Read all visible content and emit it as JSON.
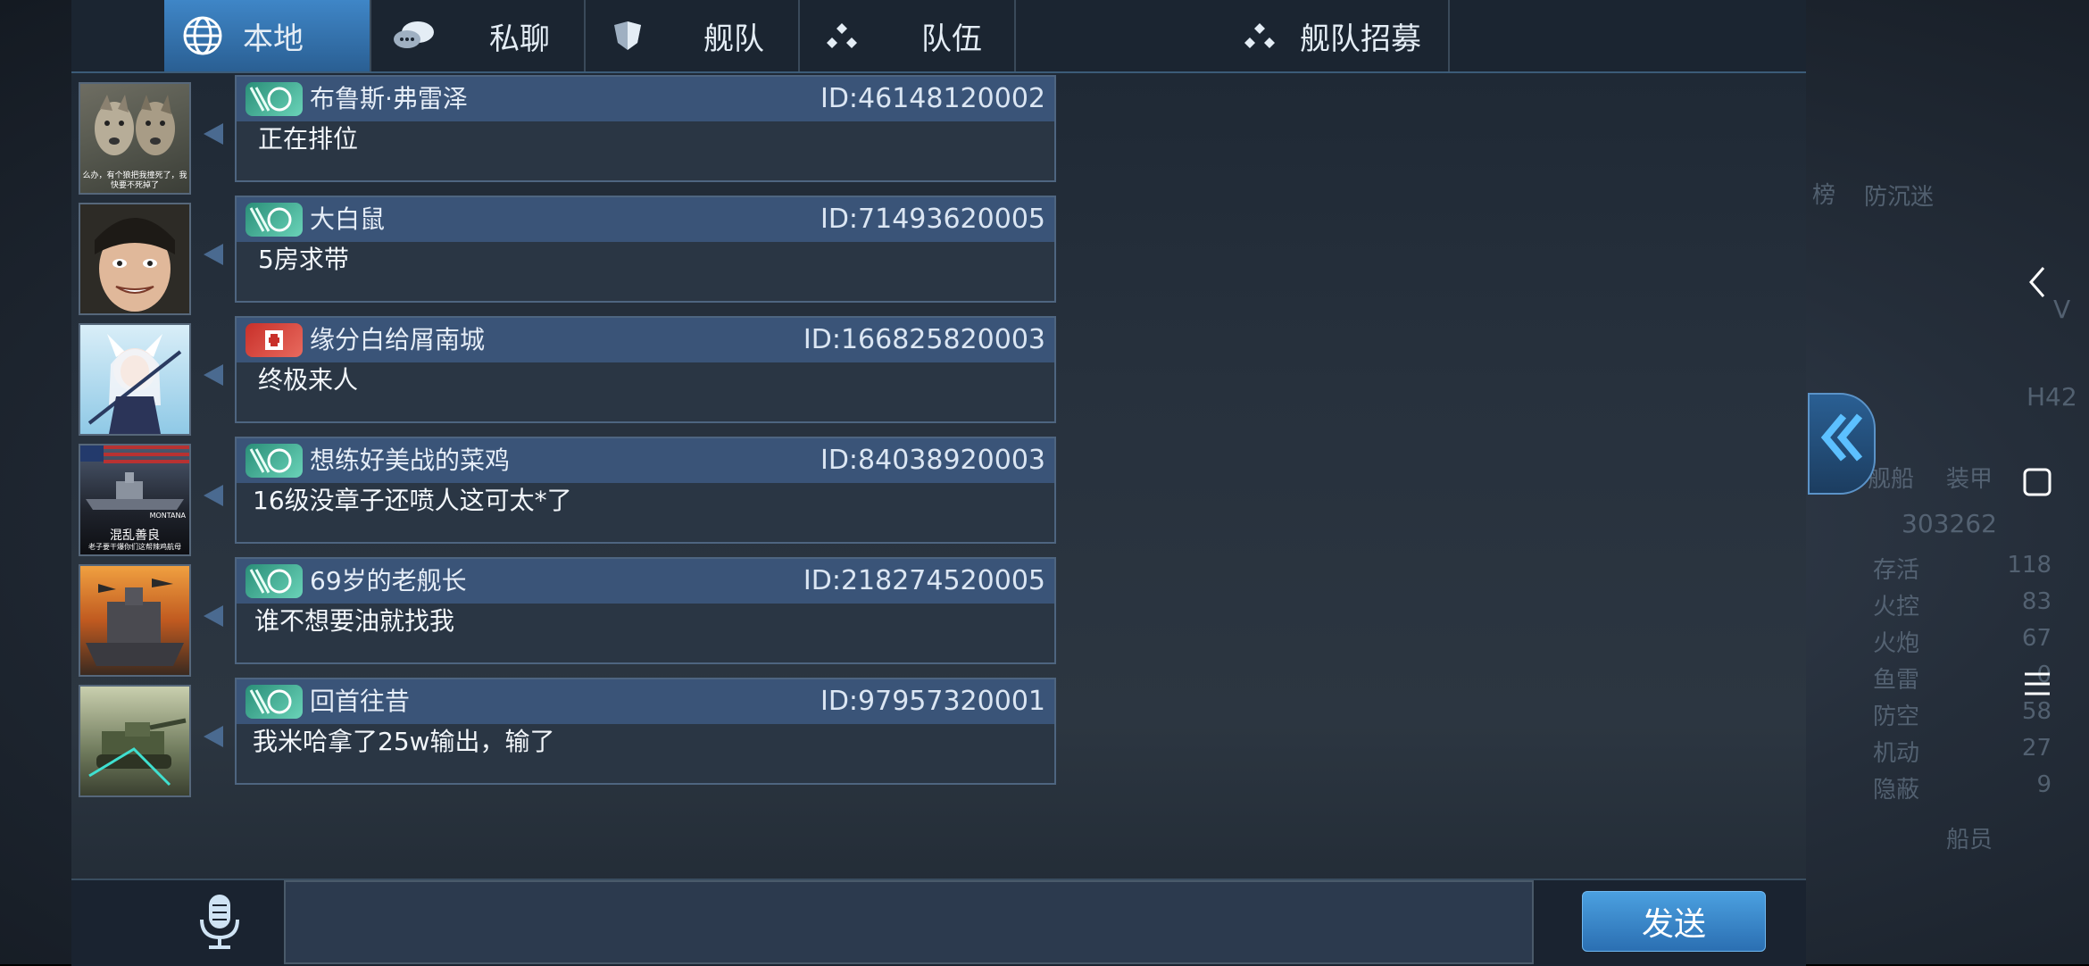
{
  "tabs": [
    {
      "label": "本地",
      "icon": "globe-icon",
      "active": true
    },
    {
      "label": "私聊",
      "icon": "chat-bubbles-icon",
      "active": false
    },
    {
      "label": "舰队",
      "icon": "fleet-shield-icon",
      "active": false
    },
    {
      "label": "队伍",
      "icon": "team-dots-icon",
      "active": false
    },
    {
      "label": "舰队招募",
      "icon": "recruit-dots-icon",
      "active": false
    }
  ],
  "messages": [
    {
      "name": "布鲁斯·弗雷泽",
      "id": "ID:46148120002",
      "text": "正在排位",
      "badge": "green",
      "avatar": "wolves-avatar"
    },
    {
      "name": "大白鼠",
      "id": "ID:71493620005",
      "text": "5房求带",
      "badge": "green",
      "avatar": "man-face-avatar"
    },
    {
      "name": "缘分白给屑南城",
      "id": "ID:166825820003",
      "text": "终极来人",
      "badge": "red",
      "avatar": "anime-girl-avatar"
    },
    {
      "name": "想练好美战的菜鸡",
      "id": "ID:84038920003",
      "text": "16级没章子还喷人这可太*了",
      "badge": "green",
      "avatar": "montana-avatar"
    },
    {
      "name": "69岁的老舰长",
      "id": "ID:218274520005",
      "text": "谁不想要油就找我",
      "badge": "green",
      "avatar": "battleship-avatar"
    },
    {
      "name": "回首往昔",
      "id": "ID:97957320001",
      "text": "我米哈拿了25w输出，输了",
      "badge": "green",
      "avatar": "tank-avatar"
    }
  ],
  "avatar_texts": {
    "wolves": "么办，有个狼把我撞死了，我快要不死掉了",
    "montana_ship": "MONTANA",
    "montana_title": "混乱善良",
    "montana_sub": "老子要干爆你们这帮辣鸡航母"
  },
  "input": {
    "value": "",
    "placeholder": ""
  },
  "send_label": "发送",
  "background_ghost": {
    "left_partial": "榜",
    "anti_sink": "防沉迷",
    "ship_tag": "H42",
    "vee": "V",
    "ships": "舰船",
    "equip": "装甲",
    "power": "303262",
    "stats": [
      {
        "label": "存活",
        "value": "118"
      },
      {
        "label": "火控",
        "value": "83"
      },
      {
        "label": "火炮",
        "value": "67"
      },
      {
        "label": "鱼雷",
        "value": "0"
      },
      {
        "label": "防空",
        "value": "58"
      },
      {
        "label": "机动",
        "value": "27"
      },
      {
        "label": "隐蔽",
        "value": "9"
      }
    ],
    "crew_button": "船员"
  },
  "colors": {
    "accent": "#3f86c7",
    "badge_green": "#2a8e78",
    "badge_red": "#c8302a",
    "send": "#2b6fb2"
  }
}
